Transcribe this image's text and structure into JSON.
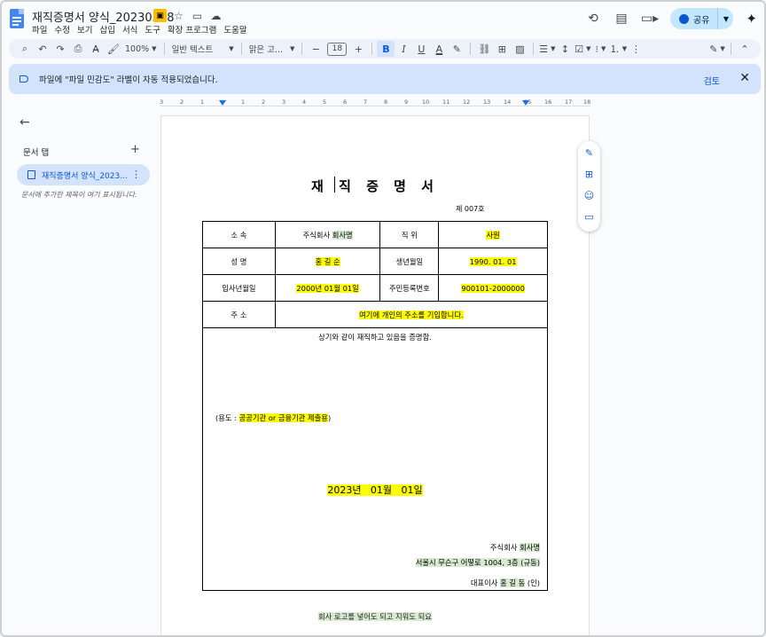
{
  "app": {
    "doc_title": "재직증명서 양식_20230328",
    "menu": [
      "파일",
      "수정",
      "보기",
      "삽입",
      "서식",
      "도구",
      "확장 프로그램",
      "도움말"
    ],
    "share_label": "공유",
    "icons": [
      "label-icon",
      "star-icon",
      "move-icon",
      "cloud-icon",
      "history-icon",
      "comment-icon",
      "meet-icon",
      "gemini-icon"
    ]
  },
  "toolbar": {
    "zoom": "100%",
    "style": "일반 텍스트",
    "font": "맑은 고...",
    "font_size": "18"
  },
  "banner": {
    "text": "파일에 \"파일 민감도\" 라벨이 자동 적용되었습니다.",
    "review": "검토"
  },
  "ruler": [
    "3",
    "2",
    "1",
    "1",
    "2",
    "3",
    "4",
    "5",
    "6",
    "7",
    "8",
    "9",
    "10",
    "11",
    "12",
    "13",
    "14",
    "15",
    "16",
    "17",
    "18"
  ],
  "sidebar": {
    "title": "문서 탭",
    "tab_label": "재직증명서 양식_2023...",
    "hint": "문서에 추가한 제목이 여기 표시됩니다."
  },
  "document": {
    "heading": "재 직 증 명 서",
    "number": "제 007호",
    "rows": [
      {
        "l1": "소 속",
        "v1a": "주식회사 ",
        "v1b": "회사명",
        "l2": "직 위",
        "v2": "사원"
      },
      {
        "l1": "성 명",
        "v1": "홍 길 순",
        "l2": "생년월일",
        "v2": "1990. 01. 01"
      },
      {
        "l1": "입사년월일",
        "v1": "2000년 01월 01일",
        "l2": "주민등록번호",
        "v2": "900101-2000000"
      }
    ],
    "address_label": "주 소",
    "address_value": "여기에 개인의 주소를 기입합니다.",
    "certify_line": "상기와 같이 재직하고 있음을 증명함.",
    "purpose_prefix": "(용도 : ",
    "purpose_value": "공공기관 or 금융기관 제출용",
    "purpose_suffix": ")",
    "date": "2023년   01월   01일",
    "company_prefix": "주식회사 ",
    "company_name": "회사명",
    "company_address": "서울시 무슨구 어떻로 1004, 3층 (규동)",
    "ceo_prefix": "대표이사 ",
    "ceo_name": "홍 길 동",
    "ceo_seal": " (인)",
    "footer_note": "회사 로고를 넣어도 되고 지워도 되요"
  }
}
